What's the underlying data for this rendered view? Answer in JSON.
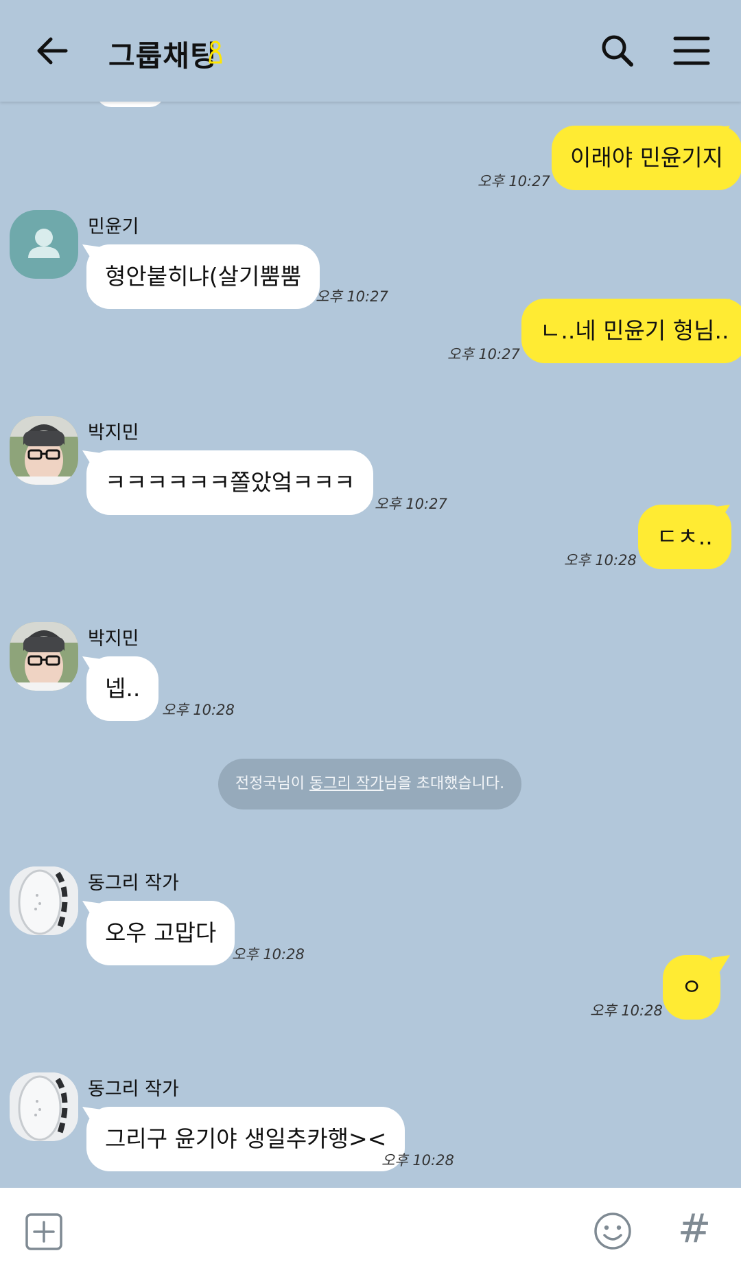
{
  "header": {
    "title": "그룹채팅"
  },
  "messages": [
    {
      "text": "이래야 민윤기지",
      "time": "오후 10:27"
    },
    {
      "sender": "민윤기",
      "text": "형안붙히냐(살기뿜뿜",
      "time": "오후 10:27"
    },
    {
      "text": "ㄴ..네 민윤기 형님..",
      "time": "오후 10:27"
    },
    {
      "sender": "박지민",
      "text": "ㅋㅋㅋㅋㅋㅋ쫄았엌ㅋㅋㅋ",
      "time": "오후 10:27"
    },
    {
      "text": "ㄷㅊ..",
      "time": "오후 10:28"
    },
    {
      "sender": "박지민",
      "text": "넵..",
      "time": "오후 10:28"
    },
    {
      "sender": "동그리 작가",
      "text": "오우 고맙다",
      "time": "오후 10:28"
    },
    {
      "text": "ㅇ",
      "time": "오후 10:28"
    },
    {
      "sender": "동그리 작가",
      "text": "그리구 윤기야 생일추카행><",
      "time": "오후 10:28"
    }
  ],
  "system_notice": {
    "prefix": "전정국님이 ",
    "link": "동그리 작가",
    "suffix": "님을 초대했습니다."
  },
  "colors": {
    "background": "#b2c7da",
    "my_bubble": "#ffeb33",
    "other_bubble": "#ffffff"
  },
  "icons": {
    "back": "arrow-left-icon",
    "title_badge": "person-outline-icon",
    "search": "search-icon",
    "menu": "hamburger-menu-icon",
    "attach": "plus-square-icon",
    "emoji": "smiley-icon",
    "hash": "hash-icon"
  }
}
